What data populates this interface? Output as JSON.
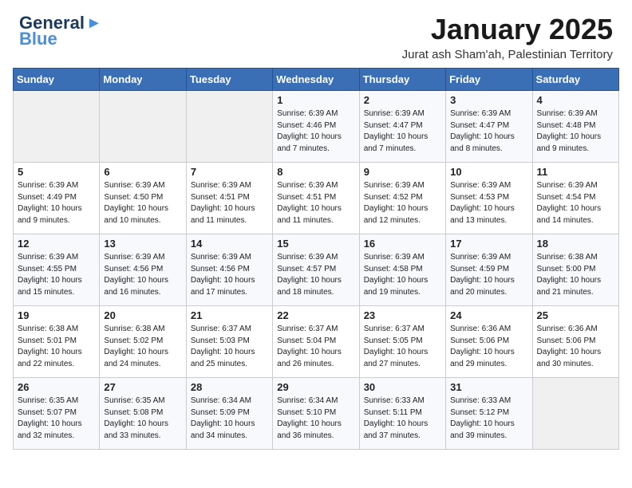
{
  "header": {
    "logo_general": "General",
    "logo_blue": "Blue",
    "month_title": "January 2025",
    "location": "Jurat ash Sham'ah, Palestinian Territory"
  },
  "days_of_week": [
    "Sunday",
    "Monday",
    "Tuesday",
    "Wednesday",
    "Thursday",
    "Friday",
    "Saturday"
  ],
  "weeks": [
    [
      {
        "day": "",
        "info": ""
      },
      {
        "day": "",
        "info": ""
      },
      {
        "day": "",
        "info": ""
      },
      {
        "day": "1",
        "info": "Sunrise: 6:39 AM\nSunset: 4:46 PM\nDaylight: 10 hours\nand 7 minutes."
      },
      {
        "day": "2",
        "info": "Sunrise: 6:39 AM\nSunset: 4:47 PM\nDaylight: 10 hours\nand 7 minutes."
      },
      {
        "day": "3",
        "info": "Sunrise: 6:39 AM\nSunset: 4:47 PM\nDaylight: 10 hours\nand 8 minutes."
      },
      {
        "day": "4",
        "info": "Sunrise: 6:39 AM\nSunset: 4:48 PM\nDaylight: 10 hours\nand 9 minutes."
      }
    ],
    [
      {
        "day": "5",
        "info": "Sunrise: 6:39 AM\nSunset: 4:49 PM\nDaylight: 10 hours\nand 9 minutes."
      },
      {
        "day": "6",
        "info": "Sunrise: 6:39 AM\nSunset: 4:50 PM\nDaylight: 10 hours\nand 10 minutes."
      },
      {
        "day": "7",
        "info": "Sunrise: 6:39 AM\nSunset: 4:51 PM\nDaylight: 10 hours\nand 11 minutes."
      },
      {
        "day": "8",
        "info": "Sunrise: 6:39 AM\nSunset: 4:51 PM\nDaylight: 10 hours\nand 11 minutes."
      },
      {
        "day": "9",
        "info": "Sunrise: 6:39 AM\nSunset: 4:52 PM\nDaylight: 10 hours\nand 12 minutes."
      },
      {
        "day": "10",
        "info": "Sunrise: 6:39 AM\nSunset: 4:53 PM\nDaylight: 10 hours\nand 13 minutes."
      },
      {
        "day": "11",
        "info": "Sunrise: 6:39 AM\nSunset: 4:54 PM\nDaylight: 10 hours\nand 14 minutes."
      }
    ],
    [
      {
        "day": "12",
        "info": "Sunrise: 6:39 AM\nSunset: 4:55 PM\nDaylight: 10 hours\nand 15 minutes."
      },
      {
        "day": "13",
        "info": "Sunrise: 6:39 AM\nSunset: 4:56 PM\nDaylight: 10 hours\nand 16 minutes."
      },
      {
        "day": "14",
        "info": "Sunrise: 6:39 AM\nSunset: 4:56 PM\nDaylight: 10 hours\nand 17 minutes."
      },
      {
        "day": "15",
        "info": "Sunrise: 6:39 AM\nSunset: 4:57 PM\nDaylight: 10 hours\nand 18 minutes."
      },
      {
        "day": "16",
        "info": "Sunrise: 6:39 AM\nSunset: 4:58 PM\nDaylight: 10 hours\nand 19 minutes."
      },
      {
        "day": "17",
        "info": "Sunrise: 6:39 AM\nSunset: 4:59 PM\nDaylight: 10 hours\nand 20 minutes."
      },
      {
        "day": "18",
        "info": "Sunrise: 6:38 AM\nSunset: 5:00 PM\nDaylight: 10 hours\nand 21 minutes."
      }
    ],
    [
      {
        "day": "19",
        "info": "Sunrise: 6:38 AM\nSunset: 5:01 PM\nDaylight: 10 hours\nand 22 minutes."
      },
      {
        "day": "20",
        "info": "Sunrise: 6:38 AM\nSunset: 5:02 PM\nDaylight: 10 hours\nand 24 minutes."
      },
      {
        "day": "21",
        "info": "Sunrise: 6:37 AM\nSunset: 5:03 PM\nDaylight: 10 hours\nand 25 minutes."
      },
      {
        "day": "22",
        "info": "Sunrise: 6:37 AM\nSunset: 5:04 PM\nDaylight: 10 hours\nand 26 minutes."
      },
      {
        "day": "23",
        "info": "Sunrise: 6:37 AM\nSunset: 5:05 PM\nDaylight: 10 hours\nand 27 minutes."
      },
      {
        "day": "24",
        "info": "Sunrise: 6:36 AM\nSunset: 5:06 PM\nDaylight: 10 hours\nand 29 minutes."
      },
      {
        "day": "25",
        "info": "Sunrise: 6:36 AM\nSunset: 5:06 PM\nDaylight: 10 hours\nand 30 minutes."
      }
    ],
    [
      {
        "day": "26",
        "info": "Sunrise: 6:35 AM\nSunset: 5:07 PM\nDaylight: 10 hours\nand 32 minutes."
      },
      {
        "day": "27",
        "info": "Sunrise: 6:35 AM\nSunset: 5:08 PM\nDaylight: 10 hours\nand 33 minutes."
      },
      {
        "day": "28",
        "info": "Sunrise: 6:34 AM\nSunset: 5:09 PM\nDaylight: 10 hours\nand 34 minutes."
      },
      {
        "day": "29",
        "info": "Sunrise: 6:34 AM\nSunset: 5:10 PM\nDaylight: 10 hours\nand 36 minutes."
      },
      {
        "day": "30",
        "info": "Sunrise: 6:33 AM\nSunset: 5:11 PM\nDaylight: 10 hours\nand 37 minutes."
      },
      {
        "day": "31",
        "info": "Sunrise: 6:33 AM\nSunset: 5:12 PM\nDaylight: 10 hours\nand 39 minutes."
      },
      {
        "day": "",
        "info": ""
      }
    ]
  ]
}
